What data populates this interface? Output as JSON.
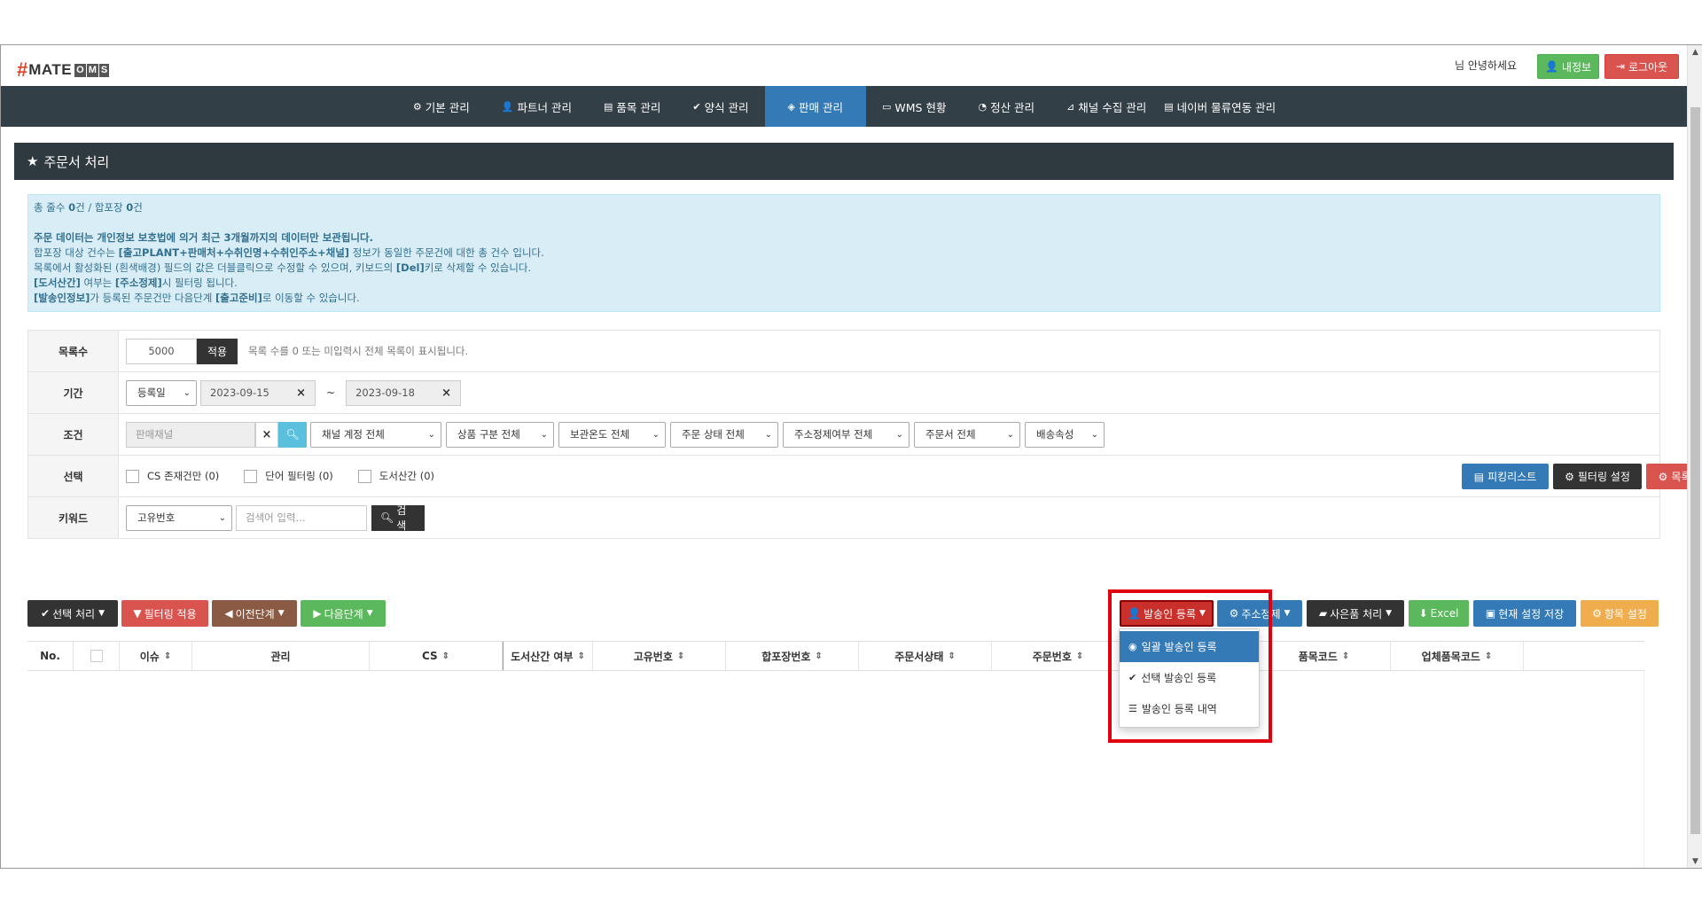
{
  "header": {
    "logo": {
      "hash": "#",
      "mate": "MATE",
      "oms": [
        "O",
        "M",
        "S"
      ]
    },
    "greeting": "님 안녕하세요",
    "my_info_label": "내정보",
    "logout_label": "로그아웃"
  },
  "nav": [
    {
      "label": "기본 관리",
      "icon": "⚙"
    },
    {
      "label": "파트너 관리",
      "icon": "👤"
    },
    {
      "label": "품목 관리",
      "icon": "▤"
    },
    {
      "label": "양식 관리",
      "icon": "✔"
    },
    {
      "label": "판매 관리",
      "icon": "◈"
    },
    {
      "label": "WMS 현황",
      "icon": "▭"
    },
    {
      "label": "정산 관리",
      "icon": "◔"
    },
    {
      "label": "채널 수집 관리",
      "icon": "⊿"
    },
    {
      "label": "네이버 물류연동 관리",
      "icon": "▤"
    }
  ],
  "panel_title": "주문서 처리",
  "info": {
    "line1_prefix": "총 줄수 ",
    "line1_count1": "0",
    "line1_mid": "건 / 합포장 ",
    "line1_count2": "0",
    "line1_suffix": "건",
    "line2": "주문 데이터는 개인정보 보호법에 의거 최근 3개월까지의 데이터만 보관됩니다.",
    "line3_a": "합포장 대상 건수는 ",
    "line3_b": "[출고PLANT+판매처+수취인명+수취인주소+채널]",
    "line3_c": " 정보가 동일한 주문건에 대한 총 건수 입니다.",
    "line4_a": "목록에서 활성화된 (흰색배경) 필드의 값은 더블클릭으로 수정할 수 있으며, 키보드의 ",
    "line4_b": "[Del]",
    "line4_c": "키로 삭제할 수 있습니다.",
    "line5_a": "[도서산간]",
    "line5_b": " 여부는 ",
    "line5_c": "[주소정제]",
    "line5_d": "시 필터링 됩니다.",
    "line6_a": "[발송인정보]",
    "line6_b": "가 등록된 주문건만 다음단계 ",
    "line6_c": "[출고준비]",
    "line6_d": "로 이동할 수 있습니다."
  },
  "filters": {
    "list_count": {
      "label": "목록수",
      "value": "5000",
      "apply": "적용",
      "hint": "목록 수를 0 또는 미입력시 전체 목록이 표시됩니다."
    },
    "period": {
      "label": "기간",
      "type": "등록일",
      "from": "2023-09-15",
      "tilde": "~",
      "to": "2023-09-18"
    },
    "condition": {
      "label": "조건",
      "channel_placeholder": "판매채널",
      "selects": [
        "채널 계정 전체",
        "상품 구분 전체",
        "보관온도 전체",
        "주문 상태 전체",
        "주소정제여부 전체",
        "주문서 전체",
        "배송속성"
      ]
    },
    "select": {
      "label": "선택",
      "checks": [
        "CS 존재건만 (0)",
        "단어 필터링 (0)",
        "도서산간 (0)"
      ],
      "picking_list": "피킹리스트",
      "filter_setting": "필터링 설정",
      "small_view": "목록 작게보기"
    },
    "keyword": {
      "label": "키워드",
      "type": "고유번호",
      "placeholder": "검색어 입력...",
      "search": "검색"
    }
  },
  "actions": {
    "select_process": "선택 처리",
    "filter_apply": "필터링 적용",
    "prev_step": "이전단계",
    "next_step": "다음단계",
    "sender_register": "발송인 등록",
    "address_refine": "주소정제",
    "gift_process": "사은품 처리",
    "excel": "Excel",
    "save_settings": "현재 설정 저장",
    "item_settings": "항목 설정"
  },
  "dropdown": [
    "일괄 발송인 등록",
    "선택 발송인 등록",
    "발송인 등록 내역"
  ],
  "table": {
    "columns": [
      "No.",
      "",
      "이슈",
      "관리",
      "CS",
      "도서산간 여부",
      "고유번호",
      "합포장번호",
      "주문서상태",
      "주문번호",
      "",
      "품목코드",
      "업체품목코드"
    ]
  },
  "colors": {
    "nav_bg": "#333f47",
    "nav_active": "#337ab7",
    "highlight": "#e0000f"
  }
}
